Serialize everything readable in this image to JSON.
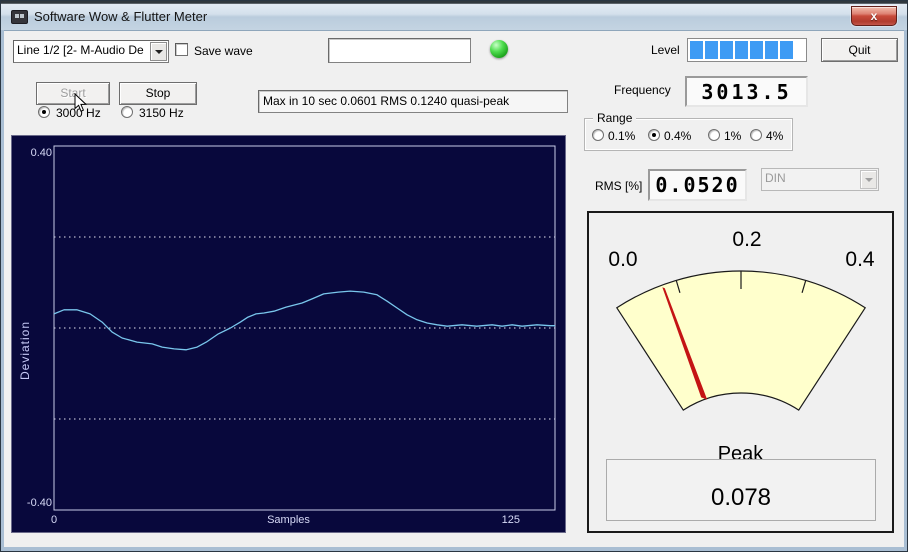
{
  "window": {
    "title": "Software Wow & Flutter Meter",
    "close_glyph": "x"
  },
  "controls": {
    "device_combo": {
      "value": "Line 1/2 [2- M-Audio De"
    },
    "save_wave": {
      "label": "Save wave",
      "checked": false
    },
    "wave_field": {
      "value": ""
    },
    "level": {
      "label": "Level",
      "filled_segments": 7,
      "total_segments": 9,
      "segment_color": "#3E9BF4"
    },
    "quit_button": {
      "label": "Quit"
    },
    "start_button": {
      "label": "Start",
      "disabled": true
    },
    "stop_button": {
      "label": "Stop",
      "disabled": false
    },
    "freq_3000": {
      "label": "3000 Hz",
      "selected": true
    },
    "freq_3150": {
      "label": "3150 Hz",
      "selected": false
    },
    "status_field": {
      "value": "Max in 10 sec 0.0601 RMS 0.1240 quasi-peak"
    },
    "frequency": {
      "label": "Frequency",
      "value": "3013.5"
    },
    "range_group": {
      "label": "Range",
      "options": [
        {
          "label": "0.1%",
          "selected": false
        },
        {
          "label": "0.4%",
          "selected": true
        },
        {
          "label": "1%",
          "selected": false
        },
        {
          "label": "4%",
          "selected": false
        }
      ]
    },
    "rms": {
      "label": "RMS [%]",
      "value": "0.0520"
    },
    "weighting_combo": {
      "value": "DIN",
      "disabled": true
    }
  },
  "meter": {
    "min": 0,
    "max": 0.4,
    "scale_labels": [
      "0.0",
      "0.2",
      "0.4"
    ],
    "ticks": [
      0.1,
      0.2,
      0.3
    ],
    "needle_value": 0.078,
    "peak_label": "Peak",
    "peak_value": "0.078",
    "face_color": "#FFFFCC",
    "outline_color": "#1A1A1A",
    "needle_color": "#C41414"
  },
  "chart_data": {
    "type": "line",
    "title": "",
    "xlabel": "Samples",
    "ylabel": "Deviation",
    "xlim": [
      0,
      125
    ],
    "ylim": [
      -0.4,
      0.4
    ],
    "ytick_labels": {
      "top": "0.40",
      "bottom": "-0.40"
    },
    "xtick_labels": {
      "left": "0",
      "right": "125"
    },
    "gridlines_y": [
      0.2,
      0,
      -0.2
    ],
    "legend": false,
    "series": [
      {
        "name": "deviation",
        "x": [
          0,
          2.5,
          5.7,
          9,
          12,
          14.5,
          17,
          20.7,
          24.5,
          27,
          30,
          33,
          35.7,
          38,
          41,
          44,
          46.5,
          48.4,
          50.4,
          52.4,
          54.9,
          57.9,
          61.9,
          64.4,
          67.3,
          70.9,
          73.9,
          77.3,
          80.6,
          83.1,
          85.6,
          88.1,
          90.6,
          93.1,
          95.6,
          98.1,
          101.8,
          105.5,
          109.3,
          111.8,
          114.3,
          116.8,
          120.5,
          123.8,
          125
        ],
        "y": [
          0.031,
          0.04,
          0.04,
          0.031,
          0.013,
          -0.009,
          -0.022,
          -0.031,
          -0.035,
          -0.042,
          -0.046,
          -0.048,
          -0.042,
          -0.031,
          -0.013,
          0.0,
          0.013,
          0.024,
          0.031,
          0.033,
          0.037,
          0.046,
          0.055,
          0.064,
          0.075,
          0.079,
          0.081,
          0.079,
          0.073,
          0.059,
          0.044,
          0.029,
          0.018,
          0.011,
          0.007,
          0.004,
          0.007,
          0.004,
          0.007,
          0.004,
          0.007,
          0.004,
          0.007,
          0.005,
          0.005
        ]
      }
    ],
    "colors": {
      "background": "#08083C",
      "line": "#79C6EC",
      "axis": "#C9CDE8",
      "grid": "#EFEFFA",
      "text": "#D6D9F6"
    }
  }
}
